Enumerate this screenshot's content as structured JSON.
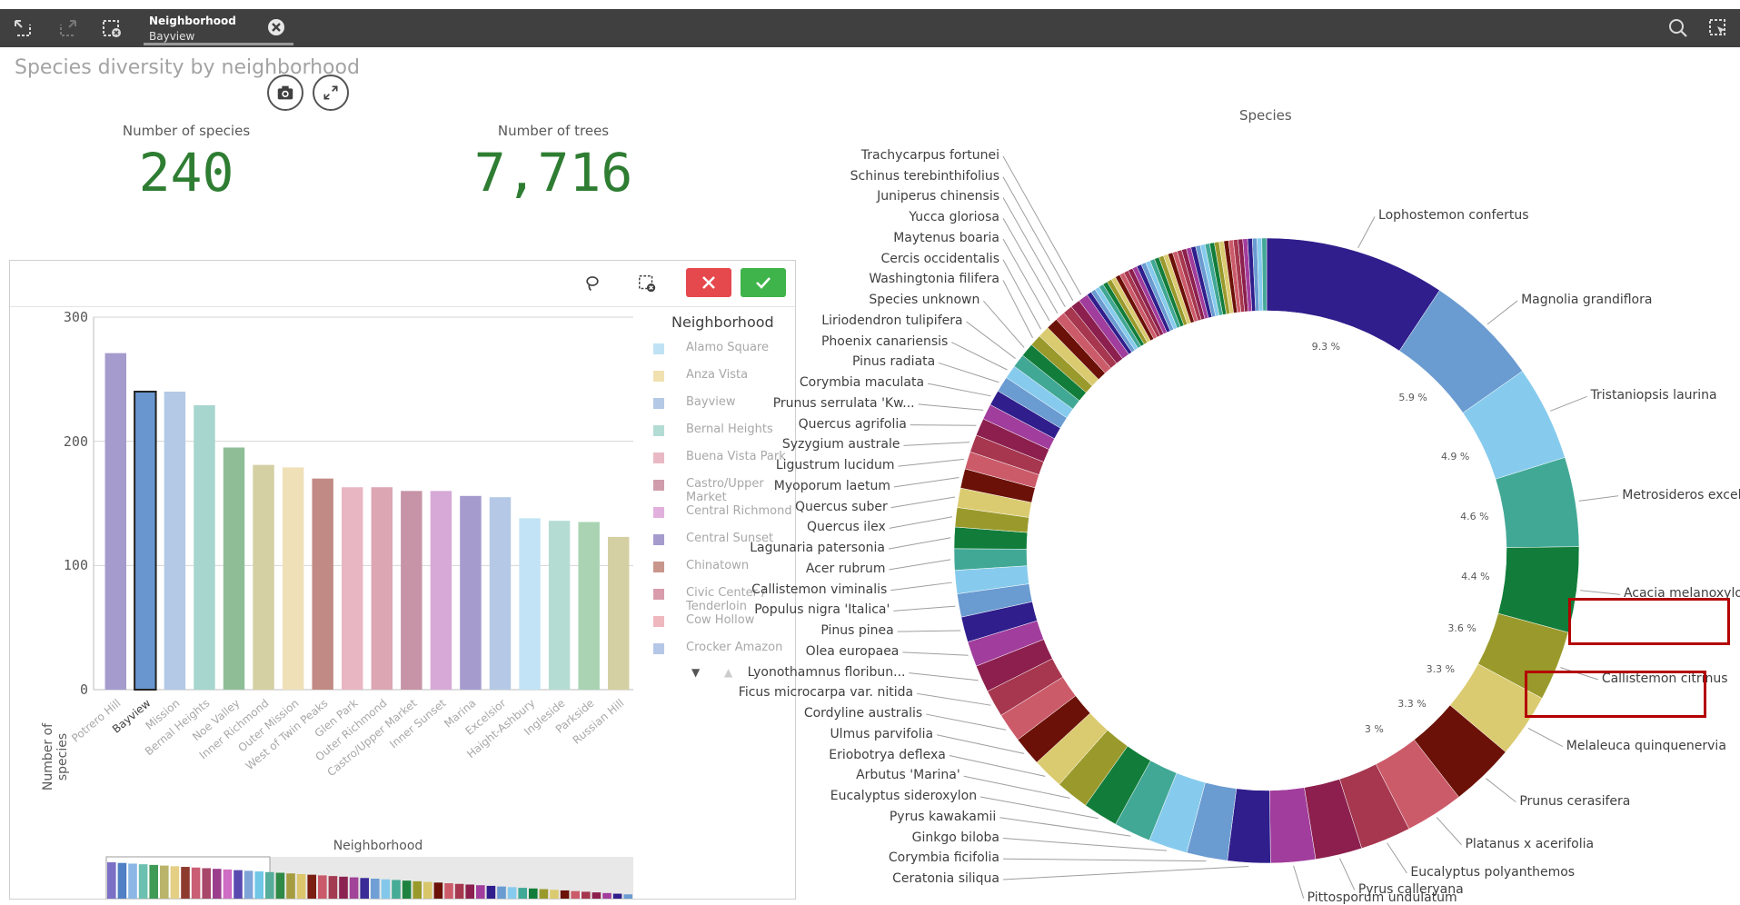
{
  "toolbar": {
    "selection_field": "Neighborhood",
    "selection_value": "Bayview"
  },
  "sheet": {
    "title": "Species diversity by neighborhood"
  },
  "kpis": [
    {
      "label": "Number of species",
      "value": "240"
    },
    {
      "label": "Number of trees",
      "value": "7,716"
    }
  ],
  "icons": {
    "back": "step-back-icon",
    "forward": "step-forward-icon",
    "clear": "clear-selections-icon",
    "search": "search-icon",
    "selections": "selections-tool-icon",
    "snapshot": "camera-icon",
    "expand": "expand-icon",
    "lasso": "lasso-icon"
  },
  "colors": {
    "kpi": "#2e7d32",
    "cancel": "#e5484d",
    "confirm": "#3fb44a",
    "highlight": "#b30000"
  },
  "bar_legend": {
    "title": "Neighborhood",
    "items": [
      {
        "label": "Alamo Square",
        "color": "#bfe3f5"
      },
      {
        "label": "Anza Vista",
        "color": "#f1e1b1"
      },
      {
        "label": "Bayview",
        "color": "#b3c9e6"
      },
      {
        "label": "Bernal Heights",
        "color": "#b3dcd4"
      },
      {
        "label": "Buena Vista Park",
        "color": "#e8b9c4"
      },
      {
        "label": "Castro/Upper Market",
        "color": "#cf9dac"
      },
      {
        "label": "Central Richmond",
        "color": "#e2b0dd"
      },
      {
        "label": "Central Sunset",
        "color": "#a59bcd"
      },
      {
        "label": "Chinatown",
        "color": "#c8968c"
      },
      {
        "label": "Civic Center / Tenderloin",
        "color": "#d99cad"
      },
      {
        "label": "Cow Hollow",
        "color": "#efb8bf"
      },
      {
        "label": "Crocker Amazon",
        "color": "#b5c7e6"
      }
    ]
  },
  "chart_data": [
    {
      "type": "bar",
      "title": "",
      "xlabel": "",
      "ylabel": "Number of species",
      "ylim": [
        0,
        300
      ],
      "yticks": [
        "300",
        "200",
        "100",
        "0"
      ],
      "categories": [
        "Potrero Hill",
        "Bayview",
        "Mission",
        "Bernal Heights",
        "Noe Valley",
        "Inner Richmond",
        "Outer Mission",
        "West of Twin Peaks",
        "Glen Park",
        "Outer Richmond",
        "Castro/Upper Market",
        "Inner Sunset",
        "Marina",
        "Excelsior",
        "Haight-Ashbury",
        "Ingleside",
        "Parkside",
        "Russian Hill"
      ],
      "values": [
        271,
        240,
        240,
        229,
        195,
        181,
        179,
        170,
        163,
        163,
        160,
        160,
        156,
        155,
        138,
        136,
        135,
        123
      ],
      "colors": [
        "#a59bcd",
        "#6996cf",
        "#b3c9e6",
        "#a6d6cd",
        "#8fbe96",
        "#d4d0a3",
        "#f0e0b8",
        "#c28a84",
        "#e8b6c2",
        "#dca6b3",
        "#c694a6",
        "#d7a9d7",
        "#a59bcd",
        "#b5c9e6",
        "#c1e3f5",
        "#b5dcd2",
        "#a9d3b2",
        "#d4d0a3"
      ],
      "selected": "Bayview",
      "scrollbar_title": "Neighborhood"
    },
    {
      "type": "pie",
      "title": "Species",
      "series": [
        {
          "label": "Lophostemon confertus",
          "pct": 9.3,
          "pct_label": "9.3 %",
          "color": "#2f1e8c"
        },
        {
          "label": "Magnolia grandiflora",
          "pct": 5.9,
          "pct_label": "5.9 %",
          "color": "#6a9bd1"
        },
        {
          "label": "Tristaniopsis laurina",
          "pct": 4.9,
          "pct_label": "4.9 %",
          "color": "#86cbed"
        },
        {
          "label": "Metrosideros excelsa",
          "pct": 4.6,
          "pct_label": "4.6 %",
          "color": "#41a896"
        },
        {
          "label": "Acacia melanoxylon",
          "pct": 4.4,
          "pct_label": "4.4 %",
          "color": "#127d3a"
        },
        {
          "label": "Callistemon citrinus",
          "pct": 3.6,
          "pct_label": "3.6 %",
          "color": "#9a9a2c"
        },
        {
          "label": "Melaleuca quinquenervia",
          "pct": 3.3,
          "pct_label": "3.3 %",
          "color": "#dbcb70"
        },
        {
          "label": "Prunus cerasifera",
          "pct": 3.3,
          "pct_label": "3.3 %",
          "color": "#6b1108"
        },
        {
          "label": "Platanus x acerifolia",
          "pct": 3.0,
          "pct_label": "3 %",
          "color": "#cc5b6a"
        },
        {
          "label": "Eucalyptus polyanthemos",
          "pct": 2.6,
          "pct_label": "",
          "color": "#a6374e"
        },
        {
          "label": "Pyrus calleryana",
          "pct": 2.4,
          "pct_label": "",
          "color": "#8c1f4e"
        },
        {
          "label": "Pittosporum undulatum",
          "pct": 2.3,
          "pct_label": "",
          "color": "#a13d9c"
        },
        {
          "label": "Ceratonia siliqua",
          "pct": 2.2,
          "pct_label": "",
          "color": "#2f1e8c"
        },
        {
          "label": "Corymbia ficifolia",
          "pct": 2.1,
          "pct_label": "",
          "color": "#6a9bd1"
        },
        {
          "label": "Ginkgo biloba",
          "pct": 2.0,
          "pct_label": "",
          "color": "#86cbed"
        },
        {
          "label": "Pyrus kawakamii",
          "pct": 1.9,
          "pct_label": "",
          "color": "#41a896"
        },
        {
          "label": "Eucalyptus sideroxylon",
          "pct": 1.8,
          "pct_label": "",
          "color": "#127d3a"
        },
        {
          "label": "Arbutus 'Marina'",
          "pct": 1.7,
          "pct_label": "",
          "color": "#9a9a2c"
        },
        {
          "label": "Eriobotrya deflexa",
          "pct": 1.6,
          "pct_label": "",
          "color": "#dbcb70"
        },
        {
          "label": "Ulmus parvifolia",
          "pct": 1.5,
          "pct_label": "",
          "color": "#6b1108"
        },
        {
          "label": "Cordyline australis",
          "pct": 1.5,
          "pct_label": "",
          "color": "#cc5b6a"
        },
        {
          "label": "Ficus microcarpa var. nitida",
          "pct": 1.4,
          "pct_label": "",
          "color": "#a6374e"
        },
        {
          "label": "Lyonothamnus floribun...",
          "pct": 1.4,
          "pct_label": "",
          "color": "#8c1f4e"
        },
        {
          "label": "Olea europaea",
          "pct": 1.3,
          "pct_label": "",
          "color": "#a13d9c"
        },
        {
          "label": "Pinus pinea",
          "pct": 1.3,
          "pct_label": "",
          "color": "#2f1e8c"
        },
        {
          "label": "Populus nigra 'Italica'",
          "pct": 1.2,
          "pct_label": "",
          "color": "#6a9bd1"
        },
        {
          "label": "Callistemon viminalis",
          "pct": 1.2,
          "pct_label": "",
          "color": "#86cbed"
        },
        {
          "label": "Acer rubrum",
          "pct": 1.1,
          "pct_label": "",
          "color": "#41a896"
        },
        {
          "label": "Lagunaria patersonia",
          "pct": 1.1,
          "pct_label": "",
          "color": "#127d3a"
        },
        {
          "label": "Quercus ilex",
          "pct": 1.0,
          "pct_label": "",
          "color": "#9a9a2c"
        },
        {
          "label": "Quercus suber",
          "pct": 1.0,
          "pct_label": "",
          "color": "#dbcb70"
        },
        {
          "label": "Myoporum laetum",
          "pct": 1.0,
          "pct_label": "",
          "color": "#6b1108"
        },
        {
          "label": "Ligustrum lucidum",
          "pct": 0.9,
          "pct_label": "",
          "color": "#cc5b6a"
        },
        {
          "label": "Syzygium australe",
          "pct": 0.9,
          "pct_label": "",
          "color": "#a6374e"
        },
        {
          "label": "Quercus agrifolia",
          "pct": 0.9,
          "pct_label": "",
          "color": "#8c1f4e"
        },
        {
          "label": "Prunus serrulata 'Kw...",
          "pct": 0.8,
          "pct_label": "",
          "color": "#a13d9c"
        },
        {
          "label": "Corymbia maculata",
          "pct": 0.8,
          "pct_label": "",
          "color": "#2f1e8c"
        },
        {
          "label": "Pinus radiata",
          "pct": 0.8,
          "pct_label": "",
          "color": "#6a9bd1"
        },
        {
          "label": "Phoenix canariensis",
          "pct": 0.7,
          "pct_label": "",
          "color": "#86cbed"
        },
        {
          "label": "Liriodendron tulipifera",
          "pct": 0.7,
          "pct_label": "",
          "color": "#41a896"
        },
        {
          "label": "Species unknown",
          "pct": 0.7,
          "pct_label": "",
          "color": "#127d3a"
        },
        {
          "label": "Washingtonia filifera",
          "pct": 0.6,
          "pct_label": "",
          "color": "#9a9a2c"
        },
        {
          "label": "Cercis occidentalis",
          "pct": 0.6,
          "pct_label": "",
          "color": "#dbcb70"
        },
        {
          "label": "Maytenus boaria",
          "pct": 0.6,
          "pct_label": "",
          "color": "#6b1108"
        },
        {
          "label": "Yucca gloriosa",
          "pct": 0.5,
          "pct_label": "",
          "color": "#cc5b6a"
        },
        {
          "label": "Juniperus chinensis",
          "pct": 0.5,
          "pct_label": "",
          "color": "#a6374e"
        },
        {
          "label": "Schinus terebinthifolius",
          "pct": 0.5,
          "pct_label": "",
          "color": "#8c1f4e"
        },
        {
          "label": "Trachycarpus fortunei",
          "pct": 0.5,
          "pct_label": "",
          "color": "#a13d9c"
        }
      ],
      "other_pct": 9.7,
      "highlighted": [
        "Callistemon citrinus",
        "Melaleuca quinquenervia"
      ]
    }
  ]
}
